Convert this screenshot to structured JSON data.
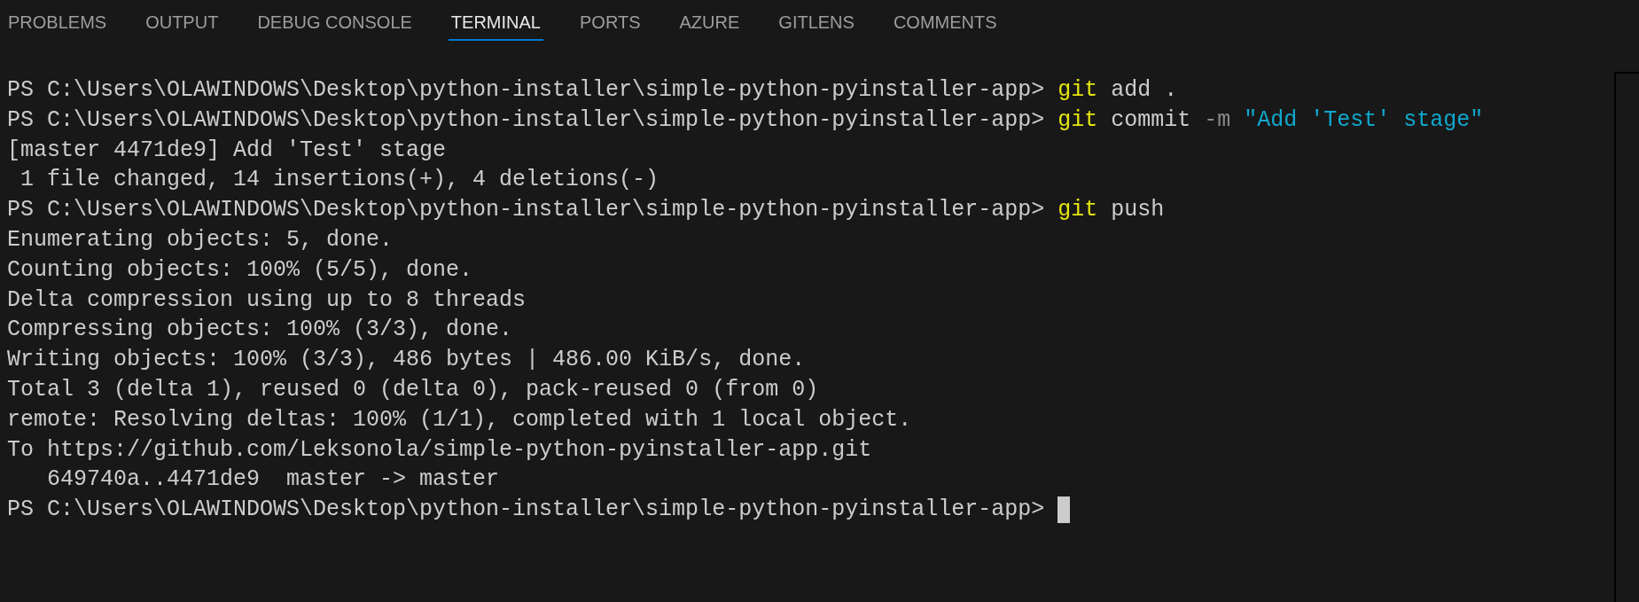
{
  "tabs": [
    {
      "label": "PROBLEMS",
      "selected": false
    },
    {
      "label": "OUTPUT",
      "selected": false
    },
    {
      "label": "DEBUG CONSOLE",
      "selected": false
    },
    {
      "label": "TERMINAL",
      "selected": true
    },
    {
      "label": "PORTS",
      "selected": false
    },
    {
      "label": "AZURE",
      "selected": false
    },
    {
      "label": "GITLENS",
      "selected": false
    },
    {
      "label": "COMMENTS",
      "selected": false
    }
  ],
  "terminal": {
    "lines": [
      {
        "cursor": false,
        "segments": [
          {
            "kind": "prompt",
            "text": "PS C:\\Users\\OLAWINDOWS\\Desktop\\python-installer\\simple-python-pyinstaller-app> "
          },
          {
            "kind": "program",
            "text": "git"
          },
          {
            "kind": "arg",
            "text": " add ."
          }
        ]
      },
      {
        "cursor": false,
        "segments": [
          {
            "kind": "prompt",
            "text": "PS C:\\Users\\OLAWINDOWS\\Desktop\\python-installer\\simple-python-pyinstaller-app> "
          },
          {
            "kind": "program",
            "text": "git"
          },
          {
            "kind": "arg",
            "text": " commit "
          },
          {
            "kind": "flag",
            "text": "-m"
          },
          {
            "kind": "string",
            "text": " \"Add 'Test' stage\""
          }
        ]
      },
      {
        "cursor": false,
        "segments": [
          {
            "kind": "output",
            "text": "[master 4471de9] Add 'Test' stage"
          }
        ]
      },
      {
        "cursor": false,
        "segments": [
          {
            "kind": "output",
            "text": " 1 file changed, 14 insertions(+), 4 deletions(-)"
          }
        ]
      },
      {
        "cursor": false,
        "segments": [
          {
            "kind": "prompt",
            "text": "PS C:\\Users\\OLAWINDOWS\\Desktop\\python-installer\\simple-python-pyinstaller-app> "
          },
          {
            "kind": "program",
            "text": "git"
          },
          {
            "kind": "arg",
            "text": " push"
          }
        ]
      },
      {
        "cursor": false,
        "segments": [
          {
            "kind": "output",
            "text": "Enumerating objects: 5, done."
          }
        ]
      },
      {
        "cursor": false,
        "segments": [
          {
            "kind": "output",
            "text": "Counting objects: 100% (5/5), done."
          }
        ]
      },
      {
        "cursor": false,
        "segments": [
          {
            "kind": "output",
            "text": "Delta compression using up to 8 threads"
          }
        ]
      },
      {
        "cursor": false,
        "segments": [
          {
            "kind": "output",
            "text": "Compressing objects: 100% (3/3), done."
          }
        ]
      },
      {
        "cursor": false,
        "segments": [
          {
            "kind": "output",
            "text": "Writing objects: 100% (3/3), 486 bytes | 486.00 KiB/s, done."
          }
        ]
      },
      {
        "cursor": false,
        "segments": [
          {
            "kind": "output",
            "text": "Total 3 (delta 1), reused 0 (delta 0), pack-reused 0 (from 0)"
          }
        ]
      },
      {
        "cursor": false,
        "segments": [
          {
            "kind": "output",
            "text": "remote: Resolving deltas: 100% (1/1), completed with 1 local object."
          }
        ]
      },
      {
        "cursor": false,
        "segments": [
          {
            "kind": "output",
            "text": "To https://github.com/Leksonola/simple-python-pyinstaller-app.git"
          }
        ]
      },
      {
        "cursor": false,
        "segments": [
          {
            "kind": "output",
            "text": "   649740a..4471de9  master -> master"
          }
        ]
      },
      {
        "cursor": true,
        "segments": [
          {
            "kind": "prompt",
            "text": "PS C:\\Users\\OLAWINDOWS\\Desktop\\python-installer\\simple-python-pyinstaller-app> "
          }
        ]
      }
    ]
  }
}
